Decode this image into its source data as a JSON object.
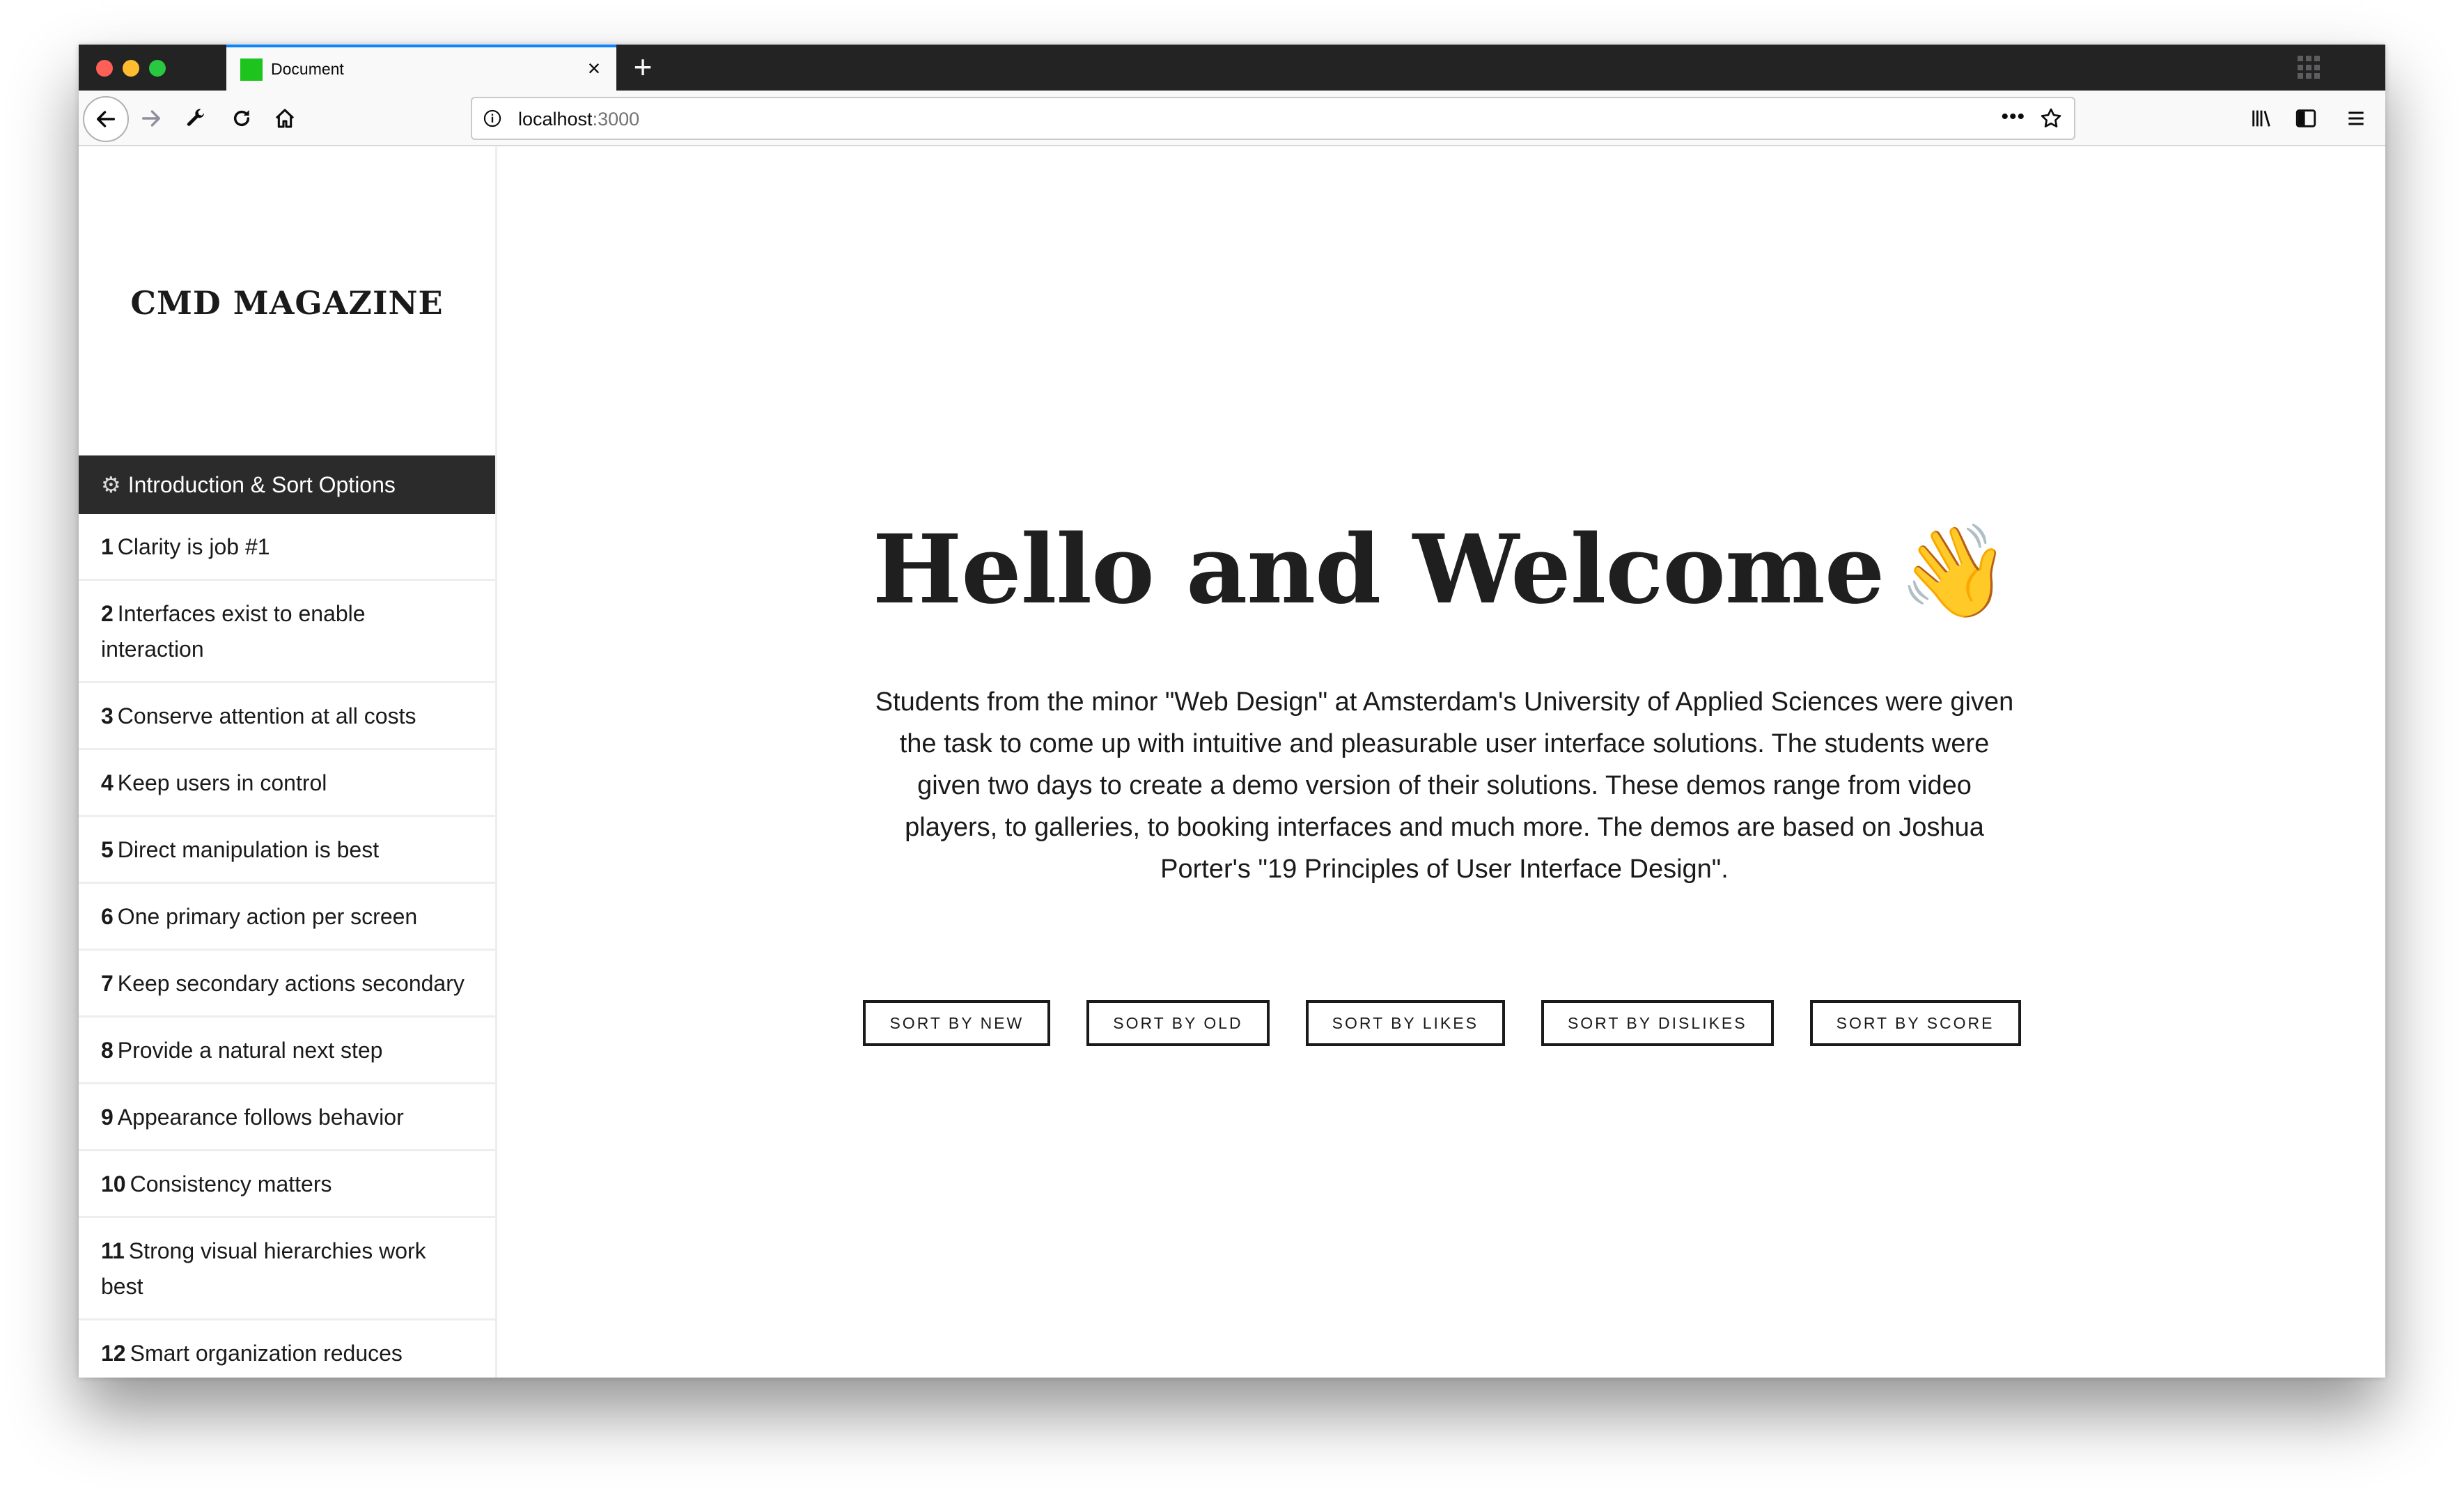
{
  "browser": {
    "tab_title": "Document",
    "tab_close": "×",
    "new_tab": "+",
    "url_host": "localhost",
    "url_port": ":3000",
    "url_more": "•••"
  },
  "sidebar": {
    "brand": "CMD MAGAZINE",
    "active_item": "Introduction & Sort Options",
    "items": [
      {
        "num": "1",
        "label": "Clarity is job #1"
      },
      {
        "num": "2",
        "label": "Interfaces exist to enable interaction"
      },
      {
        "num": "3",
        "label": "Conserve attention at all costs"
      },
      {
        "num": "4",
        "label": "Keep users in control"
      },
      {
        "num": "5",
        "label": "Direct manipulation is best"
      },
      {
        "num": "6",
        "label": "One primary action per screen"
      },
      {
        "num": "7",
        "label": "Keep secondary actions secondary"
      },
      {
        "num": "8",
        "label": "Provide a natural next step"
      },
      {
        "num": "9",
        "label": "Appearance follows behavior"
      },
      {
        "num": "10",
        "label": "Consistency matters"
      },
      {
        "num": "11",
        "label": "Strong visual hierarchies work best"
      },
      {
        "num": "12",
        "label": "Smart organization reduces cognitive load"
      }
    ]
  },
  "main": {
    "title": "Hello and Welcome",
    "title_emoji": "👋",
    "intro": "Students from the minor \"Web Design\" at Amsterdam's University of Applied Sciences were given the task to come up with intuitive and pleasurable user interface solutions. The students were given two days to create a demo version of their solutions. These demos range from video players, to galleries, to booking interfaces and much more. The demos are based on Joshua Porter's \"19 Principles of User Interface Design\".",
    "sort_buttons": [
      "SORT BY NEW",
      "SORT BY OLD",
      "SORT BY LIKES",
      "SORT BY DISLIKES",
      "SORT BY SCORE"
    ]
  },
  "colors": {
    "tab_accent": "#0a84ff",
    "favicon": "#1ec41e",
    "active_nav_bg": "#2b2b2b"
  }
}
